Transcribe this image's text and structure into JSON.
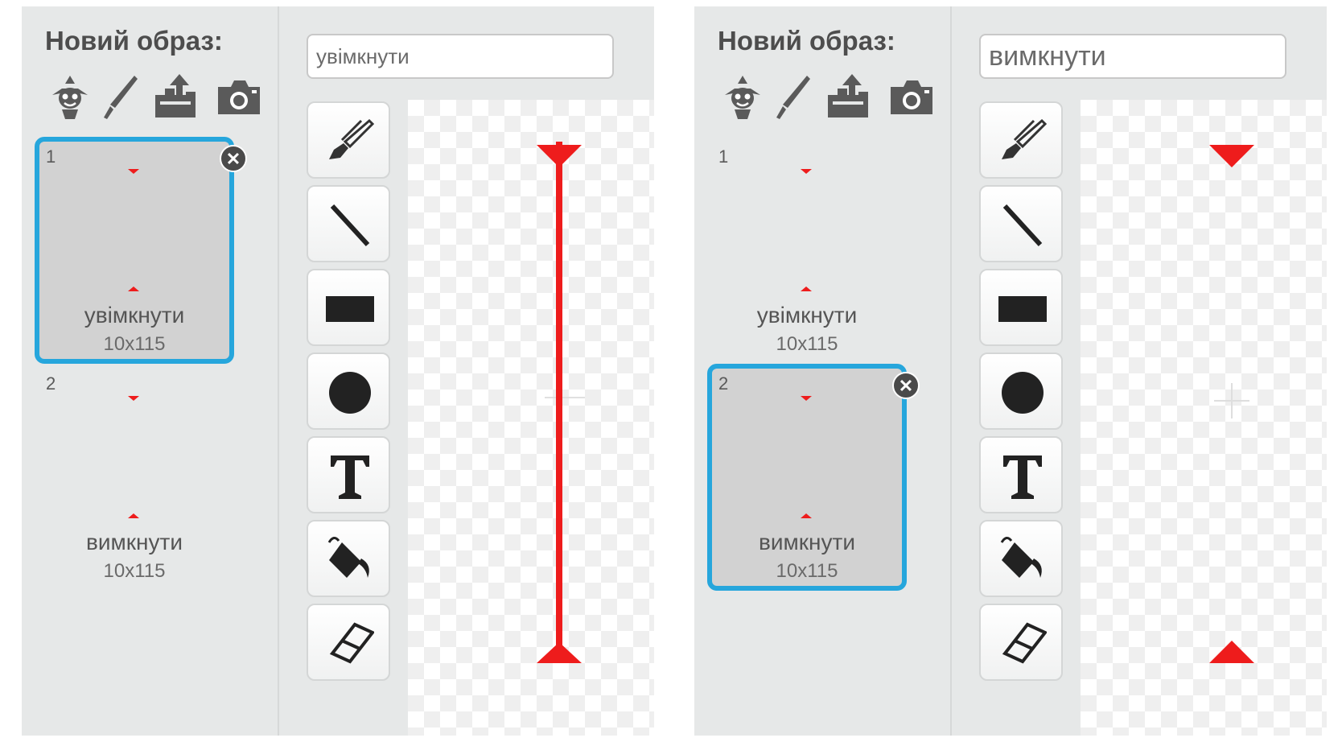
{
  "editors": [
    {
      "title": "Новий образ:",
      "name_field_value": "увімкнути",
      "selected_index": 1,
      "costumes": [
        {
          "number": "1",
          "name": "увімкнути",
          "size": "10x115"
        },
        {
          "number": "2",
          "name": "вимкнути",
          "size": "10x115"
        }
      ],
      "canvas_shows": "line"
    },
    {
      "title": "Новий образ:",
      "name_field_value": "вимкнути",
      "selected_index": 2,
      "costumes": [
        {
          "number": "1",
          "name": "увімкнути",
          "size": "10x115"
        },
        {
          "number": "2",
          "name": "вимкнути",
          "size": "10x115"
        }
      ],
      "canvas_shows": "arrowheads-only"
    }
  ],
  "new_costume_icons": [
    "sprite-library-icon",
    "paint-brush-icon",
    "upload-icon",
    "camera-icon"
  ],
  "tools": [
    "brush-tool-icon",
    "line-tool-icon",
    "rectangle-tool-icon",
    "ellipse-tool-icon",
    "text-tool-icon",
    "fill-tool-icon",
    "eraser-tool-icon"
  ],
  "colors": {
    "selection_border": "#26a6dc",
    "costume_red": "#ee1c1c",
    "panel_bg": "#e6e8e8",
    "tile_bg": "#d2d2d2"
  }
}
